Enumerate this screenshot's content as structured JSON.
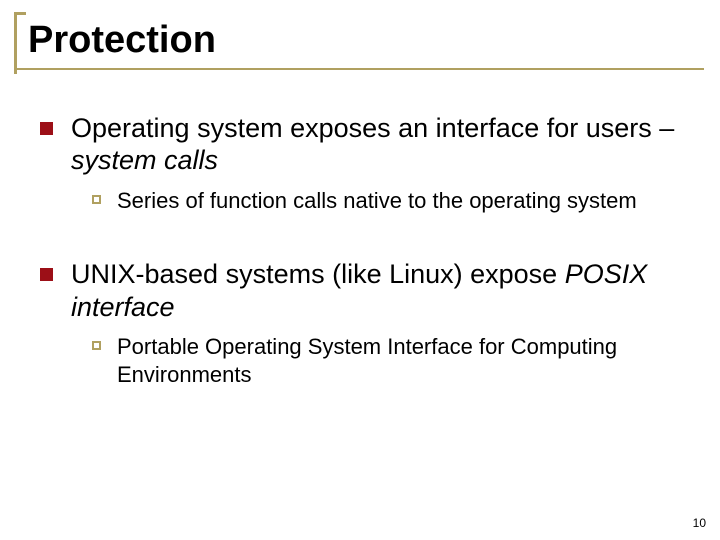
{
  "title": "Protection",
  "bullets": [
    {
      "text_plain": "Operating system exposes an interface for users – ",
      "text_em": "system calls",
      "sub": {
        "text": "Series of function calls native to the operating system"
      }
    },
    {
      "text_plain": "UNIX-based systems (like Linux) expose ",
      "text_em": "POSIX interface",
      "sub": {
        "text": "Portable Operating System Interface for Computing Environments"
      }
    }
  ],
  "page_number": "10"
}
